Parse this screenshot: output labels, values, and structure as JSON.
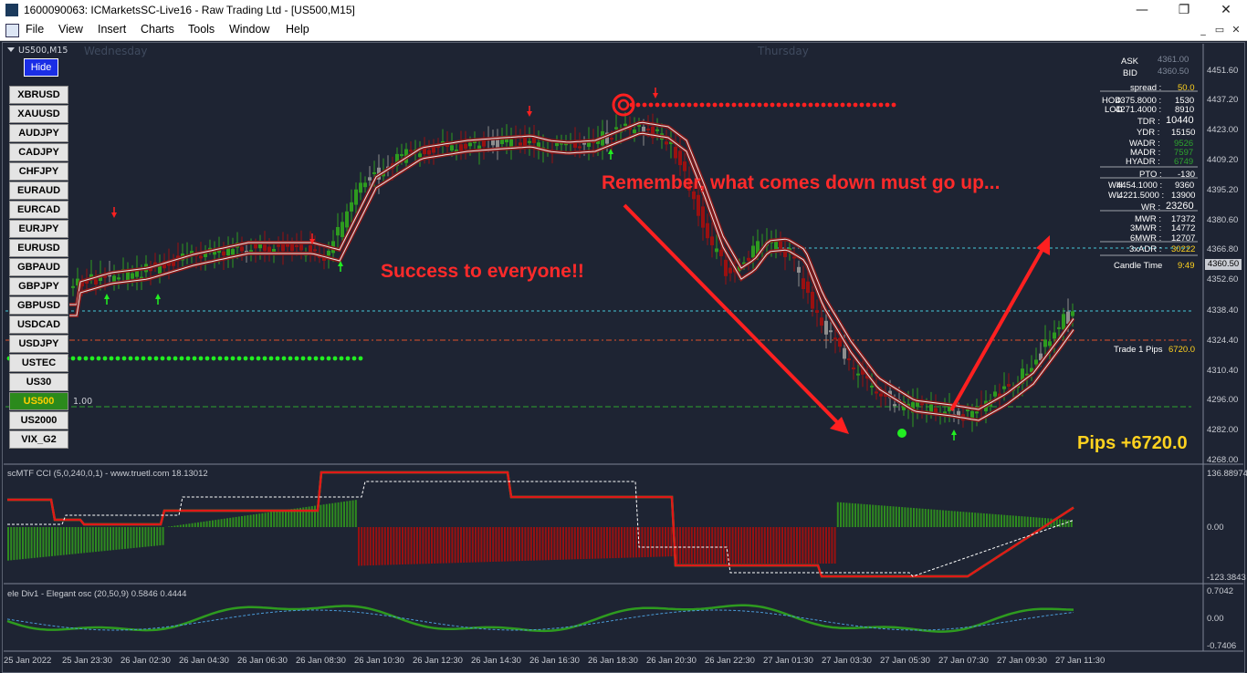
{
  "window": {
    "title": "1600090063: ICMarketsSC-Live16 - Raw Trading Ltd - [US500,M15]",
    "min": "—",
    "max": "❐",
    "close": "✕"
  },
  "menu": [
    "File",
    "View",
    "Insert",
    "Charts",
    "Tools",
    "Window",
    "Help"
  ],
  "mdi": {
    "min": "_",
    "restore": "▭",
    "close": "✕"
  },
  "chart": {
    "symbol": "US500,M15",
    "hide_label": "Hide",
    "days": [
      "Wednesday",
      "Thursday"
    ],
    "symbols": [
      "XBRUSD",
      "XAUUSD",
      "AUDJPY",
      "CADJPY",
      "CHFJPY",
      "EURAUD",
      "EURCAD",
      "EURJPY",
      "EURUSD",
      "GBPAUD",
      "GBPJPY",
      "GBPUSD",
      "USDCAD",
      "USDJPY",
      "USTEC",
      "US30",
      "US500",
      "US2000",
      "VIX_G2"
    ],
    "active_symbol": "US500",
    "lot_label": "1.00",
    "annotation_top": "Remember, what comes down must go up...",
    "annotation_mid": "Success to everyone!!",
    "pips_text": "Pips +6720.0",
    "price_ticks": [
      "4451.60",
      "4437.20",
      "4423.00",
      "4409.20",
      "4395.20",
      "4380.60",
      "4366.80",
      "4352.60",
      "4338.40",
      "4324.40",
      "4310.40",
      "4296.00",
      "4282.00",
      "4268.00"
    ],
    "current_price": "4360.50",
    "time_ticks": [
      "25 Jan 2022",
      "25 Jan 23:30",
      "26 Jan 02:30",
      "26 Jan 04:30",
      "26 Jan 06:30",
      "26 Jan 08:30",
      "26 Jan 10:30",
      "26 Jan 12:30",
      "26 Jan 14:30",
      "26 Jan 16:30",
      "26 Jan 18:30",
      "26 Jan 20:30",
      "26 Jan 22:30",
      "27 Jan 01:30",
      "27 Jan 03:30",
      "27 Jan 05:30",
      "27 Jan 07:30",
      "27 Jan 09:30",
      "27 Jan 11:30"
    ]
  },
  "info_panel": {
    "ask_label": "ASK",
    "ask": "4361.00",
    "bid_label": "BID",
    "bid": "4360.50",
    "spread_label": "spread :",
    "spread": "50.0",
    "hod_label": "HOD",
    "hod_price": "4375.8000 :",
    "hod_val": "1530",
    "lod_label": "LOD",
    "lod_price": "4271.4000 :",
    "lod_val": "8910",
    "tdr_label": "TDR :",
    "tdr": "10440",
    "ydr_label": "YDR :",
    "ydr": "15150",
    "wadr_label": "WADR :",
    "wadr": "9526",
    "madr_label": "MADR :",
    "madr": "7597",
    "hyadr_label": "HYADR :",
    "hyadr": "6749",
    "pto_label": "PTO :",
    "pto": "-130",
    "wh_label": "WH",
    "wh_price": "4454.1000 :",
    "wh_val": "9360",
    "wl_label": "WL",
    "wl_price": "4221.5000 :",
    "wl_val": "13900",
    "wr_label": "WR :",
    "wr": "23260",
    "mwr_label": "MWR :",
    "mwr": "17372",
    "mwr3_label": "3MWR :",
    "mwr3": "14772",
    "mwr6_label": "6MWR :",
    "mwr6": "12707",
    "adr3_label": "3xADR :",
    "adr3": "30222",
    "candle_label": "Candle Time",
    "candle": "9:49",
    "trade_label": "Trade 1 Pips",
    "trade": "6720.0"
  },
  "cci": {
    "label": "scMTF CCI (5,0,240,0,1) - www.truetl.com 18.13012",
    "ticks": [
      "136.88974",
      "0.00",
      "-123.3843"
    ]
  },
  "osc": {
    "label": "ele Div1 - Elegant osc (20,50,9) 0.5846 0.4444",
    "ticks": [
      "0.7042",
      "0.00",
      "-0.7406"
    ]
  },
  "colors": {
    "bull": "#2e9b1f",
    "bear": "#9b1010",
    "neutral": "#8e8e8e",
    "accent_red": "#ff2020",
    "accent_green": "#22ee22",
    "background": "#1e2433",
    "pips": "#ffd21f"
  }
}
